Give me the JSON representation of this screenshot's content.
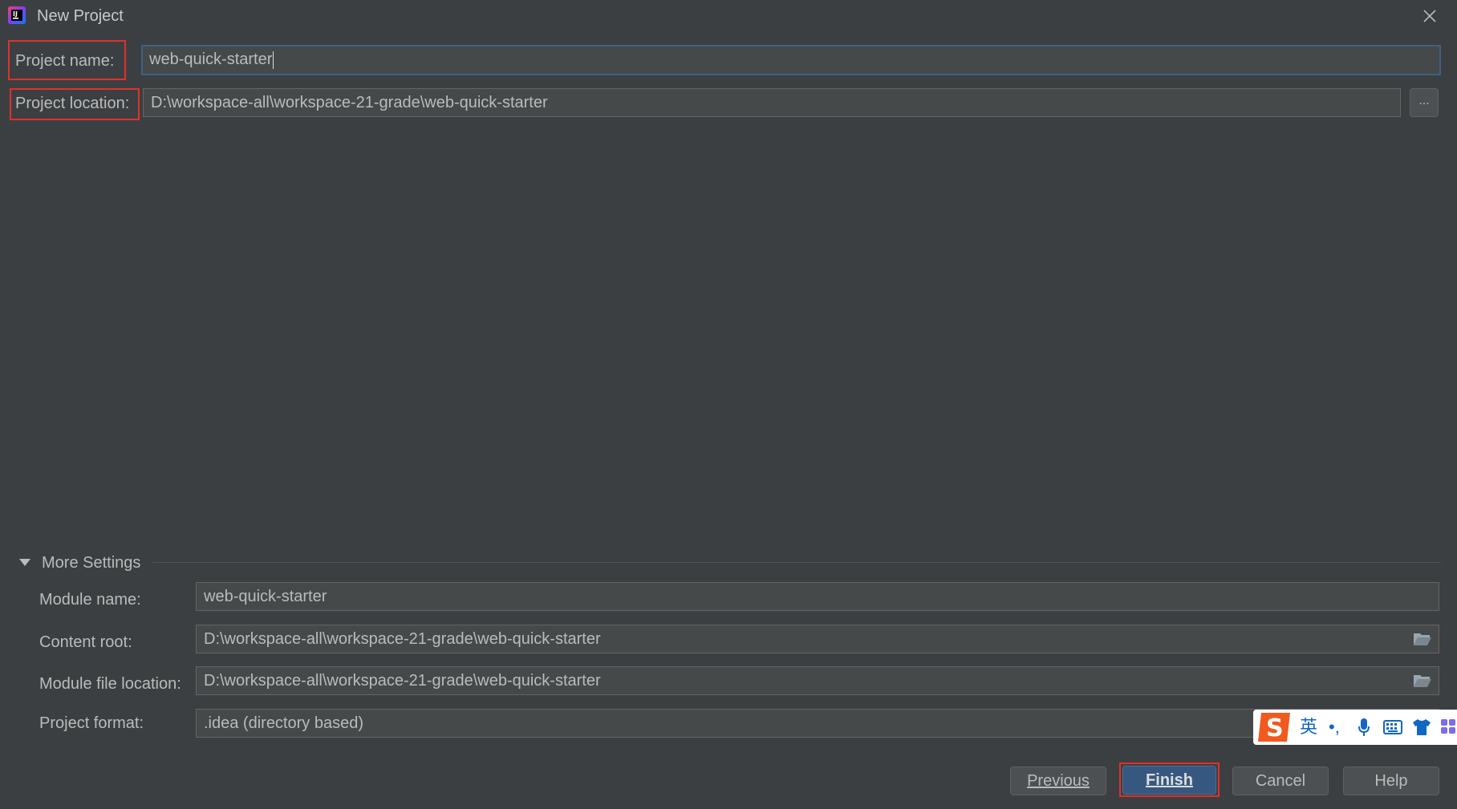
{
  "window": {
    "title": "New Project"
  },
  "form": {
    "project_name": {
      "label": "Project name:",
      "value": "web-quick-starter"
    },
    "project_location": {
      "label": "Project location:",
      "value": "D:\\workspace-all\\workspace-21-grade\\web-quick-starter",
      "browse_label": "..."
    }
  },
  "more_settings": {
    "title": "More Settings",
    "module_name": {
      "label": "Module name:",
      "value": "web-quick-starter"
    },
    "content_root": {
      "label": "Content root:",
      "value": "D:\\workspace-all\\workspace-21-grade\\web-quick-starter"
    },
    "module_file_location": {
      "label": "Module file location:",
      "value": "D:\\workspace-all\\workspace-21-grade\\web-quick-starter"
    },
    "project_format": {
      "label": "Project format:",
      "value": ".idea (directory based)"
    }
  },
  "buttons": {
    "previous": "Previous",
    "finish": "Finish",
    "cancel": "Cancel",
    "help": "Help"
  },
  "ime_toolbar": {
    "mode": "英",
    "punct": "•,",
    "icons": [
      "sogou-logo-icon",
      "microphone-icon",
      "keyboard-icon",
      "shirt-icon",
      "grid-icon"
    ]
  },
  "colors": {
    "background": "#3c3f41",
    "field": "#45494a",
    "highlight": "#e0302e",
    "primary_button": "#365880",
    "focus_border": "#3d6185"
  }
}
